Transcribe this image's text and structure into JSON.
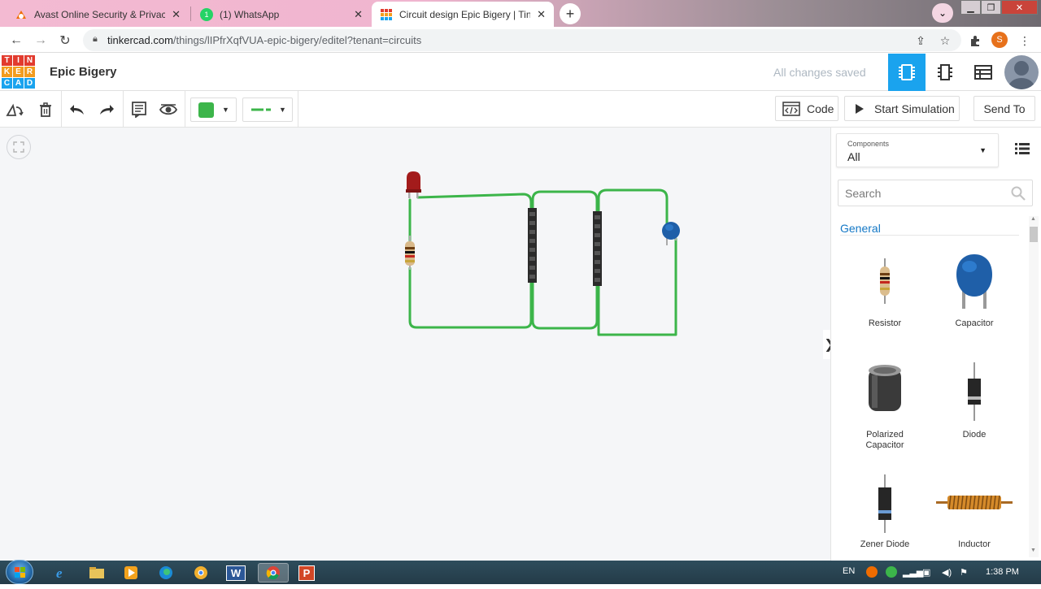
{
  "browser": {
    "tabs": [
      {
        "title": "Avast Online Security & Privacy -",
        "icon": "avast-icon",
        "active": false
      },
      {
        "title": "(1) WhatsApp",
        "icon": "whatsapp-icon",
        "badge": "1",
        "active": false
      },
      {
        "title": "Circuit design Epic Bigery | Tinker",
        "icon": "tinkercad-icon",
        "active": true
      }
    ],
    "new_tab": "+",
    "url_host": "tinkercad.com",
    "url_path": "/things/lIPfrXqfVUA-epic-bigery/editel?tenant=circuits",
    "profile_initial": "S",
    "window_controls": [
      "minimize-icon",
      "maximize-icon",
      "close-icon"
    ]
  },
  "app": {
    "logo_letters": [
      "T",
      "I",
      "N",
      "K",
      "E",
      "R",
      "C",
      "A",
      "D"
    ],
    "logo_colors": [
      "#e23b2e",
      "#e23b2e",
      "#e23b2e",
      "#f39c1e",
      "#f39c1e",
      "#f39c1e",
      "#1aa3ee",
      "#1aa3ee",
      "#1aa3ee"
    ],
    "project_name": "Epic Bigery",
    "save_status": "All changes saved",
    "accent": "#1aa3ee"
  },
  "toolbar": {
    "color_value": "#3cb54a",
    "code_label": "Code",
    "sim_label": "Start Simulation",
    "send_label": "Send To"
  },
  "panel": {
    "components_label": "Components",
    "components_value": "All",
    "search_placeholder": "Search",
    "section_title": "General",
    "items": [
      {
        "label": "Resistor",
        "icon": "resistor-icon"
      },
      {
        "label": "Capacitor",
        "icon": "capacitor-icon"
      },
      {
        "label": "Polarized Capacitor",
        "icon": "polarized-capacitor-icon"
      },
      {
        "label": "Diode",
        "icon": "diode-icon"
      },
      {
        "label": "Zener Diode",
        "icon": "zener-diode-icon"
      },
      {
        "label": "Inductor",
        "icon": "inductor-icon"
      }
    ]
  },
  "workplane": {
    "wire_color": "#3cb54a",
    "components": [
      "led",
      "resistor",
      "header-left",
      "header-right",
      "ceramic-capacitor"
    ]
  },
  "taskbar": {
    "apps": [
      "ie-icon",
      "explorer-icon",
      "media-player-icon",
      "edge-icon",
      "chrome-canary-icon",
      "word-icon",
      "chrome-icon",
      "powerpoint-icon"
    ],
    "word_letter": "W",
    "ppt_letter": "P",
    "language": "EN",
    "time": "1:38 PM"
  }
}
